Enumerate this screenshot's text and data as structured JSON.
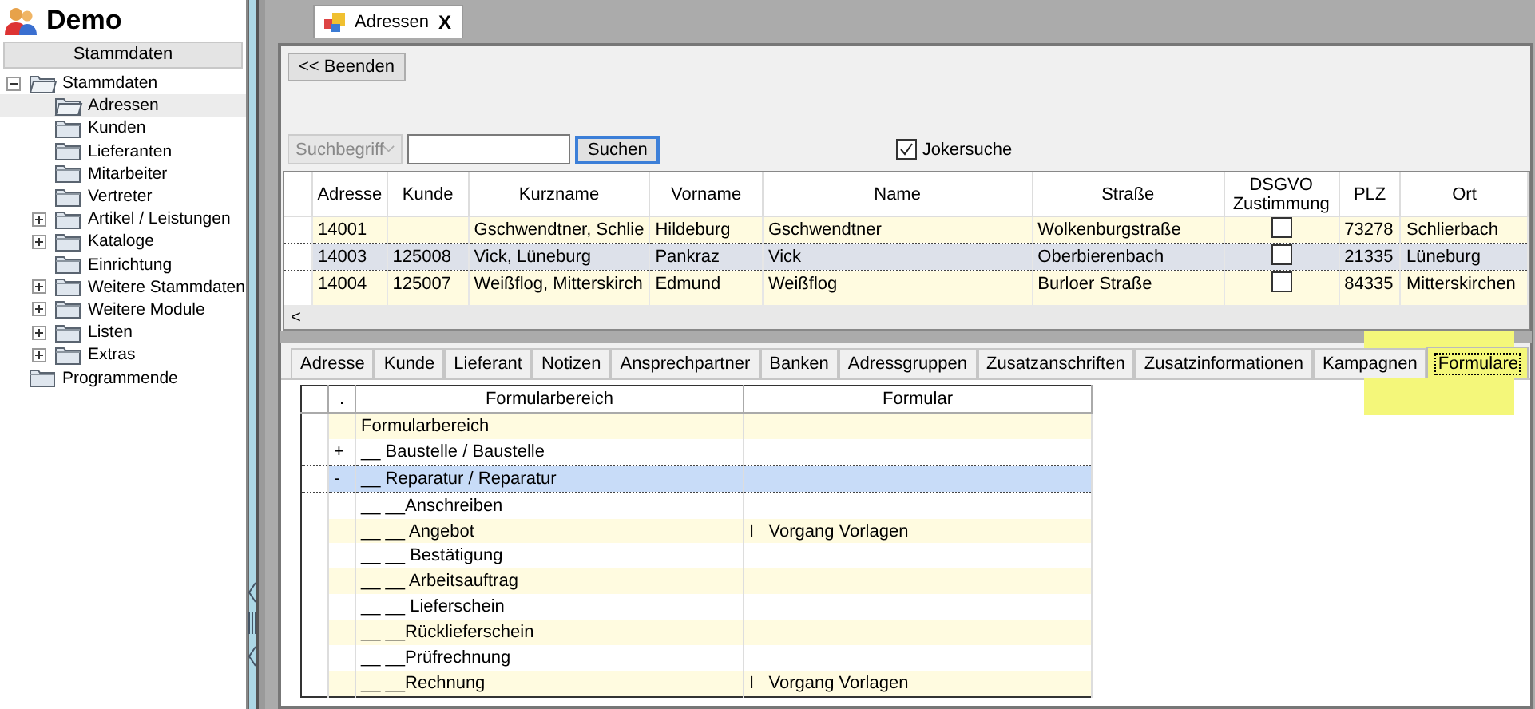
{
  "app": {
    "title": "Demo"
  },
  "sidebar": {
    "header": "Stammdaten",
    "tree": [
      {
        "label": "Stammdaten",
        "expanded": true,
        "selected": false,
        "children": [
          {
            "label": "Adressen",
            "selected": true
          },
          {
            "label": "Kunden",
            "selected": false
          },
          {
            "label": "Lieferanten",
            "selected": false
          },
          {
            "label": "Mitarbeiter",
            "selected": false
          },
          {
            "label": "Vertreter",
            "selected": false
          },
          {
            "label": "Artikel / Leistungen",
            "expanded": false,
            "selected": false
          },
          {
            "label": "Kataloge",
            "expanded": false,
            "selected": false
          },
          {
            "label": "Einrichtung",
            "selected": false
          },
          {
            "label": "Weitere Stammdaten",
            "expanded": false,
            "selected": false
          },
          {
            "label": "Weitere Module",
            "expanded": false,
            "selected": false
          },
          {
            "label": "Listen",
            "expanded": false,
            "selected": false
          },
          {
            "label": "Extras",
            "expanded": false,
            "selected": false
          }
        ]
      },
      {
        "label": "Programmende",
        "selected": false
      }
    ]
  },
  "document_tabs": [
    {
      "label": "Adressen",
      "selected": true,
      "close": "X"
    }
  ],
  "toolbar": {
    "back_button": "<< Beenden",
    "search_select": {
      "placeholder": "Suchbegriff",
      "disabled": true
    },
    "search_button": "Suchen",
    "wildcard": {
      "label": "Jokersuche",
      "checked": true
    }
  },
  "table": {
    "columns": [
      "Adresse",
      "Kunde",
      "Kurzname",
      "Vorname",
      "Name",
      "Straße",
      "DSGVO Zustimmung",
      "PLZ",
      "Ort"
    ],
    "rows": [
      {
        "selected": false,
        "adresse": "14001",
        "kunde": "",
        "kurzname": "Gschwendtner, Schlie",
        "vorname": "Hildeburg",
        "name": "Gschwendtner",
        "strasse": "Wolkenburgstraße",
        "dsgvo": false,
        "plz": "73278",
        "ort": "Schlierbach"
      },
      {
        "selected": true,
        "adresse": "14003",
        "kunde": "125008",
        "kurzname": "Vick, Lüneburg",
        "vorname": "Pankraz",
        "name": "Vick",
        "strasse": "Oberbierenbach",
        "dsgvo": false,
        "plz": "21335",
        "ort": "Lüneburg"
      },
      {
        "selected": false,
        "adresse": "14004",
        "kunde": "125007",
        "kurzname": "Weißflog, Mitterskirch",
        "vorname": "Edmund",
        "name": "Weißflog",
        "strasse": "Burloer Straße",
        "dsgvo": false,
        "plz": "84335",
        "ort": "Mitterskirchen"
      }
    ],
    "scroll_left": "<"
  },
  "detail_tabs": [
    {
      "label": "Adresse",
      "selected": false,
      "highlighted": false
    },
    {
      "label": "Kunde",
      "selected": false,
      "highlighted": false
    },
    {
      "label": "Lieferant",
      "selected": false,
      "highlighted": false
    },
    {
      "label": "Notizen",
      "selected": false,
      "highlighted": false
    },
    {
      "label": "Ansprechpartner",
      "selected": false,
      "highlighted": false
    },
    {
      "label": "Banken",
      "selected": false,
      "highlighted": false
    },
    {
      "label": "Adressgruppen",
      "selected": false,
      "highlighted": false
    },
    {
      "label": "Zusatzanschriften",
      "selected": false,
      "highlighted": false
    },
    {
      "label": "Zusatzinformationen",
      "selected": false,
      "highlighted": false
    },
    {
      "label": "Kampagnen",
      "selected": false,
      "highlighted": false
    },
    {
      "label": "Formulare",
      "selected": true,
      "highlighted": true
    }
  ],
  "form_grid": {
    "columns": [
      ".",
      "Formularbereich",
      "Formular"
    ],
    "rows": [
      {
        "selected": false,
        "bereich": "Formularbereich"
      },
      {
        "selected": false,
        "marker": "+",
        "bereich": "__ Baustelle / Baustelle"
      },
      {
        "selected": true,
        "marker": "-",
        "bereich": "__ Reparatur / Reparatur"
      },
      {
        "selected": false,
        "bereich": "__ __Anschreiben"
      },
      {
        "selected": false,
        "bereich": "__ __ Angebot",
        "flag": "I",
        "formular": "Vorgang Vorlagen"
      },
      {
        "selected": false,
        "bereich": "__ __ Bestätigung"
      },
      {
        "selected": false,
        "bereich": "__ __ Arbeitsauftrag"
      },
      {
        "selected": false,
        "bereich": "__ __ Lieferschein"
      },
      {
        "selected": false,
        "bereich": "__ __Rücklieferschein"
      },
      {
        "selected": false,
        "bereich": "__ __Prüfrechnung"
      },
      {
        "selected": false,
        "bereich": "__ __Rechnung",
        "flag": "I",
        "formular": "Vorgang Vorlagen"
      }
    ]
  }
}
